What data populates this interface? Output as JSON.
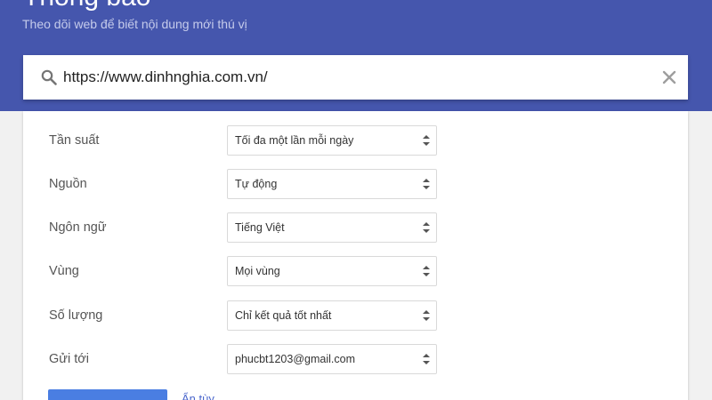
{
  "header": {
    "title": "Thông báo",
    "subtitle": "Theo dõi web để biết nội dung mới thú vị"
  },
  "search": {
    "query": "https://www.dinhnghia.com.vn/",
    "icon": "search-icon",
    "clear_icon": "close-icon"
  },
  "options": [
    {
      "label": "Tần suất",
      "value": "Tối đa một lần mỗi ngày"
    },
    {
      "label": "Nguồn",
      "value": "Tự động"
    },
    {
      "label": "Ngôn ngữ",
      "value": "Tiếng Việt"
    },
    {
      "label": "Vùng",
      "value": "Mọi vùng"
    },
    {
      "label": "Số lượng",
      "value": "Chỉ kết quả tốt nhất"
    },
    {
      "label": "Gửi tới",
      "value": "phucbt1203@gmail.com"
    }
  ],
  "actions": {
    "hide_options": "Ẩn tùy"
  },
  "colors": {
    "header_bg": "#4556ad",
    "button_bg": "#4a7ee2"
  }
}
